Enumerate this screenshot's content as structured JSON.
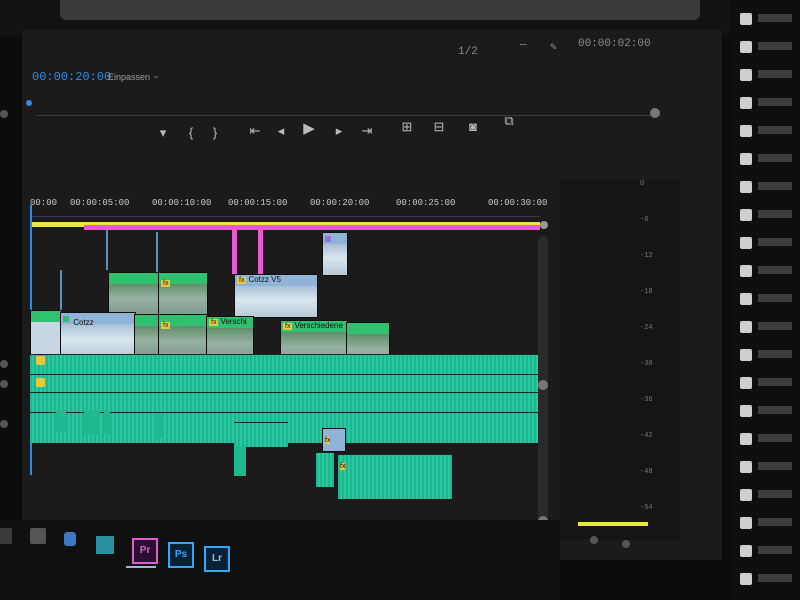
{
  "header": {
    "timecode": "00:00:20:00",
    "fit_label": "Einpassen",
    "resolution": "1/2",
    "duration": "00:00:02:00"
  },
  "transport": {
    "icons": [
      "marker-icon",
      "in-point-icon",
      "out-point-icon",
      "go-to-in-icon",
      "step-back-icon",
      "play-icon",
      "step-forward-icon",
      "go-to-out-icon",
      "insert-icon",
      "overwrite-icon",
      "export-frame-icon",
      "button-editor-icon"
    ]
  },
  "ruler": {
    "ticks": [
      "00:00",
      "00:00:05:00",
      "00:00:10:00",
      "00:00:15:00",
      "00:00:20:00",
      "00:00:25:00",
      "00:00:30:00"
    ]
  },
  "clips": {
    "v2_blue_label": "Cotzz V5",
    "v1_blue_label": "Cotzz",
    "v1_green_label": "Verschi",
    "v1_green2_label": "Verschiedene"
  },
  "taskbar": {
    "apps": [
      {
        "name": "premiere-pro",
        "label": "Pr",
        "color": "#e35ad3"
      },
      {
        "name": "photoshop",
        "label": "Ps",
        "color": "#31a8ff"
      },
      {
        "name": "lightroom",
        "label": "Lr",
        "color": "#31a8ff"
      }
    ]
  },
  "meter": {
    "ticks": [
      "0",
      "-6",
      "-12",
      "-18",
      "-24",
      "-30",
      "-36",
      "-42",
      "-48",
      "-54"
    ]
  },
  "colors": {
    "accent": "#2f8be6",
    "video_clip": "#2ec06a",
    "audio_clip": "#1fb88f",
    "work_area": "#e8e83a",
    "in_out_bar": "#e85ad0"
  }
}
